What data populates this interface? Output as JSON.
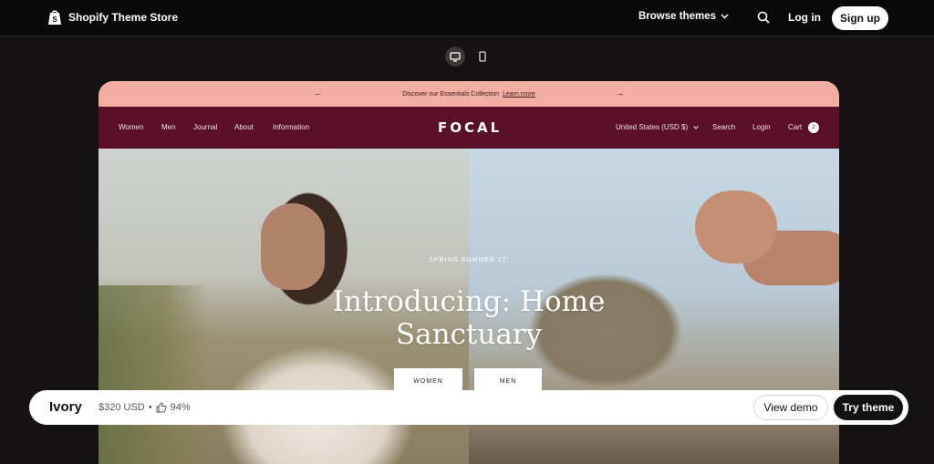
{
  "header": {
    "brand": "Shopify Theme Store",
    "browse_label": "Browse themes",
    "login_label": "Log in",
    "signup_label": "Sign up"
  },
  "announcement": {
    "message": "Discover our Essentials Collection",
    "link": "Learn more"
  },
  "store_nav": {
    "left_items": [
      "Women",
      "Men",
      "Journal",
      "About",
      "Information"
    ],
    "logo": "FOCAL",
    "country": "United States (USD $)",
    "search": "Search",
    "login": "Login",
    "cart": "Cart",
    "cart_count": "2"
  },
  "hero": {
    "eyebrow": "SPRING SUMMER 21'",
    "headline": "Introducing: Home Sanctuary",
    "buttons": [
      "WOMEN",
      "MEN"
    ]
  },
  "bottom_bar": {
    "theme_name": "Ivory",
    "price": "$320 USD",
    "separator": "•",
    "rating": "94%",
    "view_demo": "View demo",
    "try_theme": "Try theme"
  },
  "colors": {
    "announcement_bg": "#f2aea2",
    "nav_bg": "#5a1029"
  }
}
